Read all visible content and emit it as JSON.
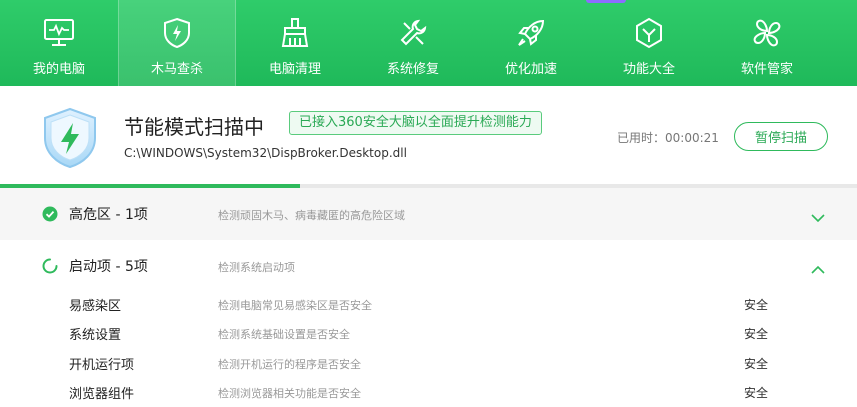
{
  "nav": {
    "items": [
      {
        "label": "我的电脑",
        "icon": "monitor-icon",
        "active": false
      },
      {
        "label": "木马查杀",
        "icon": "shield-bolt-icon",
        "active": true
      },
      {
        "label": "电脑清理",
        "icon": "broom-icon",
        "active": false
      },
      {
        "label": "系统修复",
        "icon": "wrench-icon",
        "active": false
      },
      {
        "label": "优化加速",
        "icon": "rocket-icon",
        "active": false
      },
      {
        "label": "功能大全",
        "icon": "hexagon-check-icon",
        "active": false
      },
      {
        "label": "软件管家",
        "icon": "clover-grid-icon",
        "active": false
      }
    ]
  },
  "scan": {
    "title": "节能模式扫描中",
    "badge": "已接入360安全大脑以全面提升检测能力",
    "path": "C:\\WINDOWS\\System32\\DispBroker.Desktop.dll",
    "elapsed": "已用时：00:00:21",
    "pause_label": "暂停扫描",
    "progress": 0.35
  },
  "sections": [
    {
      "title": "高危区 - 1项",
      "desc": "检测顽固木马、病毒藏匿的高危险区域",
      "status": "done",
      "expanded": false
    },
    {
      "title": "启动项 - 5项",
      "desc": "检测系统启动项",
      "status": "scanning",
      "expanded": true,
      "items": [
        {
          "name": "易感染区",
          "desc": "检测电脑常见易感染区是否安全",
          "state": "安全"
        },
        {
          "name": "系统设置",
          "desc": "检测系统基础设置是否安全",
          "state": "安全"
        },
        {
          "name": "开机运行项",
          "desc": "检测开机运行的程序是否安全",
          "state": "安全"
        },
        {
          "name": "浏览器组件",
          "desc": "检测浏览器相关功能是否安全",
          "state": "安全"
        }
      ]
    }
  ],
  "colors": {
    "brand": "#2fba5c",
    "nav_top": "#2fcc6a",
    "accent_hint": "#8c6cff"
  }
}
